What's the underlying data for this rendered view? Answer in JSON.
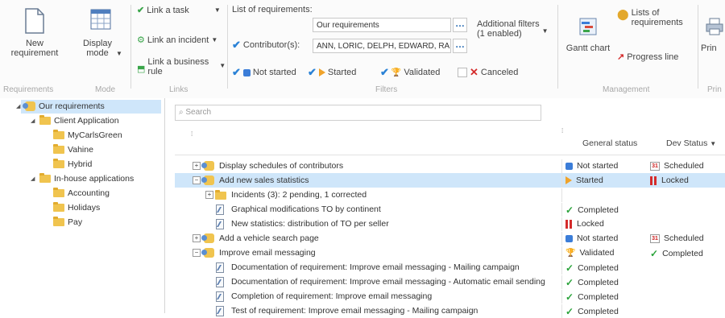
{
  "ribbon": {
    "requirements": {
      "new": "New requirement",
      "group_label": "Requirements"
    },
    "mode": {
      "display": "Display mode",
      "group_label": "Mode"
    },
    "links": {
      "link_task": "Link a task",
      "link_incident": "Link an incident",
      "link_business_rule_1": "Link a business",
      "link_business_rule_2": "rule",
      "group_label": "Links"
    },
    "filters": {
      "list_label": "List of requirements:",
      "list_value": "Our requirements",
      "contributors_label": "Contributor(s):",
      "contributors_value": "ANN, LORIC, DELPH, EDWARD, RA",
      "additional_1": "Additional filters",
      "additional_2": "(1 enabled)",
      "status_not_started": "Not started",
      "status_started": "Started",
      "status_validated": "Validated",
      "status_canceled": "Canceled",
      "group_label": "Filters"
    },
    "management": {
      "gantt": "Gantt chart",
      "lists_1": "Lists of",
      "lists_2": "requirements",
      "progress": "Progress line",
      "group_label": "Management"
    },
    "print": {
      "label": "Prin",
      "group_label": "Prin"
    }
  },
  "tree": {
    "root": "Our requirements",
    "items": [
      {
        "label": "Client Application"
      },
      {
        "label": "MyCarlsGreen"
      },
      {
        "label": "Vahine"
      },
      {
        "label": "Hybrid"
      },
      {
        "label": "In-house applications"
      },
      {
        "label": "Accounting"
      },
      {
        "label": "Holidays"
      },
      {
        "label": "Pay"
      }
    ]
  },
  "main": {
    "search_placeholder": "Search",
    "col_general": "General status",
    "col_dev": "Dev Status",
    "rows": [
      {
        "label": "Display schedules of contributors",
        "status": "Not started",
        "dev": "Scheduled"
      },
      {
        "label": "Add new sales statistics",
        "status": "Started",
        "dev": "Locked"
      },
      {
        "label": "Incidents (3): 2 pending, 1 corrected",
        "status": "",
        "dev": ""
      },
      {
        "label": "Graphical modifications TO by continent",
        "status": "Completed",
        "dev": ""
      },
      {
        "label": "New statistics: distribution of TO per seller",
        "status": "Locked",
        "dev": ""
      },
      {
        "label": "Add a vehicle search page",
        "status": "Not started",
        "dev": "Scheduled"
      },
      {
        "label": "Improve email messaging",
        "status": "Validated",
        "dev": "Completed"
      },
      {
        "label": "Documentation of requirement: Improve email messaging - Mailing campaign",
        "status": "Completed",
        "dev": ""
      },
      {
        "label": "Documentation of requirement: Improve email messaging - Automatic email sending",
        "status": "Completed",
        "dev": ""
      },
      {
        "label": "Completion of requirement: Improve email messaging",
        "status": "Completed",
        "dev": ""
      },
      {
        "label": "Test of requirement: Improve email messaging - Mailing campaign",
        "status": "Completed",
        "dev": ""
      }
    ],
    "cal_day": "31"
  }
}
